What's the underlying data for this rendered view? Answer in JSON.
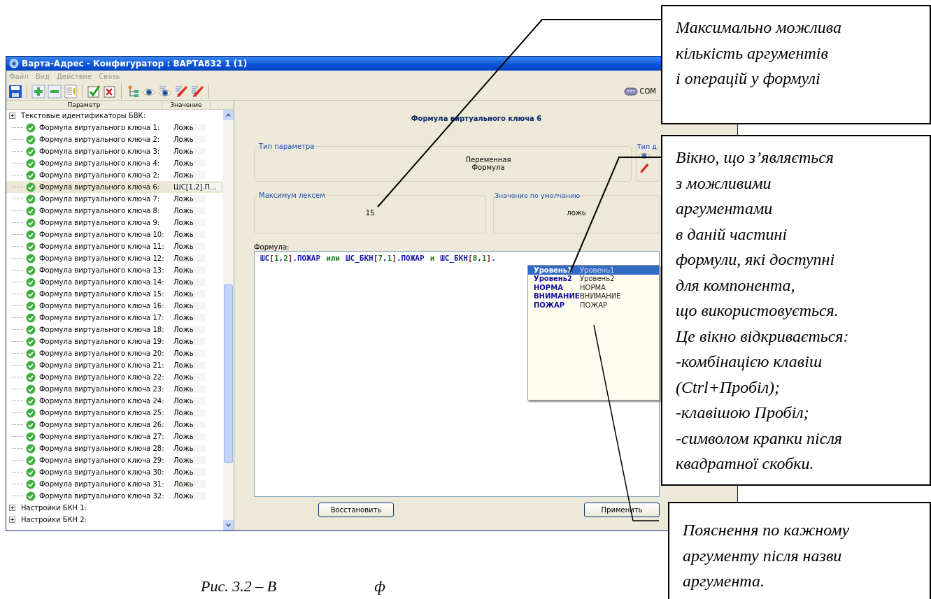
{
  "window": {
    "title": "Варта-Адрес - Конфигуратор : ВАРТА832 1 (1)"
  },
  "menu": [
    "Файл",
    "Вид",
    "Действие",
    "Связь"
  ],
  "toolbar": {
    "port_label": "COM"
  },
  "tree": {
    "columns": [
      "Параметр",
      "Значение"
    ],
    "items": [
      {
        "kind": "group",
        "label": "Текстовые идентификаторы БВК:",
        "children": [
          {
            "kind": "formula",
            "label": "Формула виртуального ключа 1:",
            "value": "Ложь",
            "selected": false
          },
          {
            "kind": "formula",
            "label": "Формула виртуального ключа 2:",
            "value": "Ложь",
            "selected": false
          },
          {
            "kind": "formula",
            "label": "Формула виртуального ключа 3:",
            "value": "Ложь",
            "selected": false
          },
          {
            "kind": "formula",
            "label": "Формула виртуального ключа 4:",
            "value": "Ложь",
            "selected": false
          },
          {
            "kind": "formula",
            "label": "Формула виртуального ключа 2:",
            "value": "Ложь",
            "selected": false
          },
          {
            "kind": "formula",
            "label": "Формула виртуального ключа 6:",
            "value": "ШС[1,2].П...",
            "selected": true
          },
          {
            "kind": "formula",
            "label": "Формула виртуального ключа 7:",
            "value": "Ложь",
            "selected": false
          },
          {
            "kind": "formula",
            "label": "Формула виртуального ключа 8:",
            "value": "Ложь",
            "selected": false
          },
          {
            "kind": "formula",
            "label": "Формула виртуального ключа 9:",
            "value": "Ложь",
            "selected": false
          },
          {
            "kind": "formula",
            "label": "Формула виртуального ключа 10:",
            "value": "Ложь",
            "selected": false
          },
          {
            "kind": "formula",
            "label": "Формула виртуального ключа 11:",
            "value": "Ложь",
            "selected": false
          },
          {
            "kind": "formula",
            "label": "Формула виртуального ключа 12:",
            "value": "Ложь",
            "selected": false
          },
          {
            "kind": "formula",
            "label": "Формула виртуального ключа 13:",
            "value": "Ложь",
            "selected": false
          },
          {
            "kind": "formula",
            "label": "Формула виртуального ключа 14:",
            "value": "Ложь",
            "selected": false
          },
          {
            "kind": "formula",
            "label": "Формула виртуального ключа 15:",
            "value": "Ложь",
            "selected": false
          },
          {
            "kind": "formula",
            "label": "Формула виртуального ключа 16:",
            "value": "Ложь",
            "selected": false
          },
          {
            "kind": "formula",
            "label": "Формула виртуального ключа 17:",
            "value": "Ложь",
            "selected": false
          },
          {
            "kind": "formula",
            "label": "Формула виртуального ключа 18:",
            "value": "Ложь",
            "selected": false
          },
          {
            "kind": "formula",
            "label": "Формула виртуального ключа 19:",
            "value": "Ложь",
            "selected": false
          },
          {
            "kind": "formula",
            "label": "Формула виртуального ключа 20:",
            "value": "Ложь",
            "selected": false
          },
          {
            "kind": "formula",
            "label": "Формула виртуального ключа 21:",
            "value": "Ложь",
            "selected": false
          },
          {
            "kind": "formula",
            "label": "Формула виртуального ключа 22:",
            "value": "Ложь",
            "selected": false
          },
          {
            "kind": "formula",
            "label": "Формула виртуального ключа 23:",
            "value": "Ложь",
            "selected": false
          },
          {
            "kind": "formula",
            "label": "Формула виртуального ключа 24:",
            "value": "Ложь",
            "selected": false
          },
          {
            "kind": "formula",
            "label": "Формула виртуального ключа 25:",
            "value": "Ложь",
            "selected": false
          },
          {
            "kind": "formula",
            "label": "Формула виртуального ключа 26:",
            "value": "Ложь",
            "selected": false
          },
          {
            "kind": "formula",
            "label": "Формула виртуального ключа 27:",
            "value": "Ложь",
            "selected": false
          },
          {
            "kind": "formula",
            "label": "Формула виртуального ключа 28:",
            "value": "Ложь",
            "selected": false
          },
          {
            "kind": "formula",
            "label": "Формула виртуального ключа 29:",
            "value": "Ложь",
            "selected": false
          },
          {
            "kind": "formula",
            "label": "Формула виртуального ключа 30:",
            "value": "Ложь",
            "selected": false
          },
          {
            "kind": "formula",
            "label": "Формула виртуального ключа 31:",
            "value": "Ложь",
            "selected": false
          },
          {
            "kind": "formula",
            "label": "Формула виртуального ключа 32:",
            "value": "Ложь",
            "selected": false
          }
        ]
      },
      {
        "kind": "group",
        "label": "Настройки БКН 1:"
      },
      {
        "kind": "group",
        "label": "Настройки БКН 2:"
      }
    ]
  },
  "details": {
    "heading": "Формула виртуального ключа 6",
    "param_type": {
      "legend": "Тип параметра",
      "lines": [
        "Переменная",
        "Формула"
      ]
    },
    "access_type": {
      "legend": "Тип д"
    },
    "max_lexemes": {
      "legend": "Максимум лексем",
      "value": "15"
    },
    "default_value": {
      "legend": "Значение по умолчанию",
      "value": "ложь"
    },
    "formula_label": "Формула:",
    "formula_tokens": [
      {
        "kind": "ident",
        "text": "ШС"
      },
      {
        "kind": "bracket",
        "text": "["
      },
      {
        "kind": "number",
        "text": "1"
      },
      {
        "kind": "punct",
        "text": ","
      },
      {
        "kind": "number",
        "text": "2"
      },
      {
        "kind": "bracket",
        "text": "]"
      },
      {
        "kind": "ident",
        "text": ".ПОЖАР"
      },
      {
        "kind": "keyword",
        "text": "или"
      },
      {
        "kind": "ident",
        "text": "ШС_БКН"
      },
      {
        "kind": "bracket",
        "text": "["
      },
      {
        "kind": "number",
        "text": "7"
      },
      {
        "kind": "punct",
        "text": ","
      },
      {
        "kind": "number",
        "text": "1"
      },
      {
        "kind": "bracket",
        "text": "]"
      },
      {
        "kind": "ident",
        "text": ".ПОЖАР"
      },
      {
        "kind": "keyword",
        "text": "и"
      },
      {
        "kind": "ident",
        "text": "ШС_БКН"
      },
      {
        "kind": "bracket",
        "text": "["
      },
      {
        "kind": "number",
        "text": "8"
      },
      {
        "kind": "punct",
        "text": ","
      },
      {
        "kind": "number",
        "text": "1"
      },
      {
        "kind": "bracket",
        "text": "]"
      },
      {
        "kind": "punct",
        "text": "."
      }
    ],
    "suggestions": [
      {
        "name": "Уровень1",
        "hint": "Уровень1",
        "selected": true
      },
      {
        "name": "Уровень2",
        "hint": "Уровень2",
        "selected": false
      },
      {
        "name": "НОРМА",
        "hint": "НОРМА",
        "selected": false
      },
      {
        "name": "ВНИМАНИЕ",
        "hint": "ВНИМАНИЕ",
        "selected": false
      },
      {
        "name": "ПОЖАР",
        "hint": "ПОЖАР",
        "selected": false
      }
    ],
    "buttons": [
      "Восстановить",
      "Применить"
    ]
  },
  "callouts": [
    "Максимально можлива\nкількість аргументів\nі операцій у формулі",
    "Вікно, що з’являється\nз можливими\nаргументами\nв даній частині\nформули, які доступні\nдля компонента,\nщо використовується.\nЦе вікно відкривається:\n-комбінацією клавіш\n(Ctrl+Пробіл);\n-клавішою Пробіл;\n-символом крапки після\nквадратної скобки.",
    "Пояснення по кажному\nаргументу після назви\nаргумента."
  ],
  "caption": [
    "Рис. 3.2 – В",
    "ф"
  ]
}
